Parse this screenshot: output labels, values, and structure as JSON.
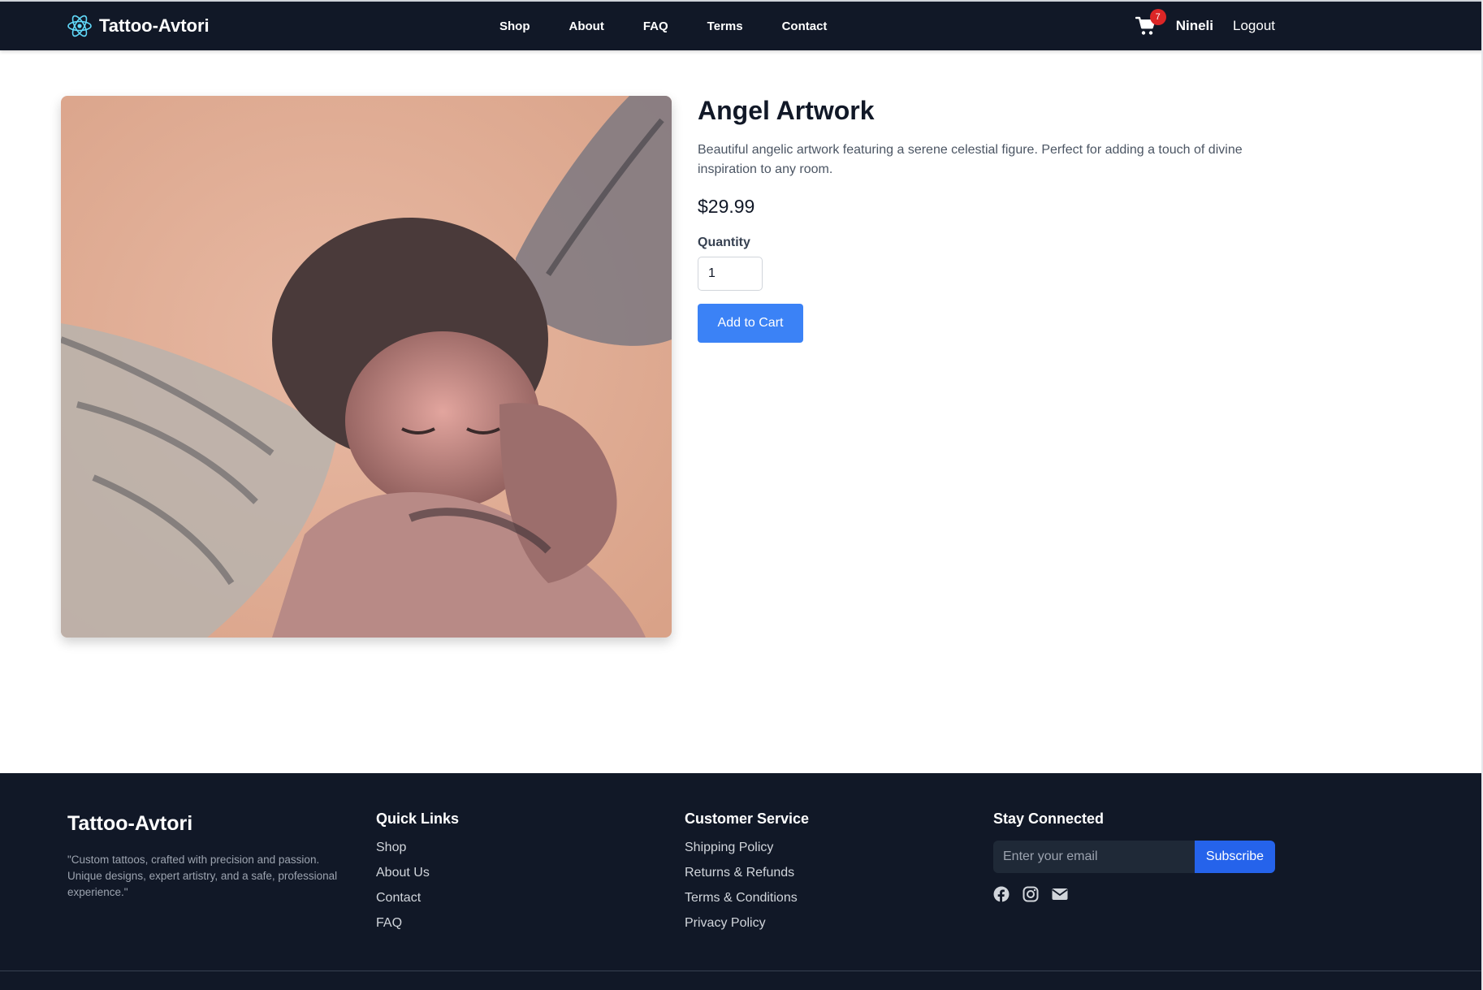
{
  "navbar": {
    "brand": "Tattoo-Avtori",
    "links": [
      "Shop",
      "About",
      "FAQ",
      "Terms",
      "Contact"
    ],
    "cart_count": "7",
    "user_name": "Nineli",
    "logout_label": "Logout"
  },
  "product": {
    "title": "Angel Artwork",
    "description": "Beautiful angelic artwork featuring a serene celestial figure. Perfect for adding a touch of divine inspiration to any room.",
    "price": "$29.99",
    "quantity_label": "Quantity",
    "quantity_value": "1",
    "add_to_cart_label": "Add to Cart"
  },
  "footer": {
    "brand": "Tattoo-Avtori",
    "quote": "\"Custom tattoos, crafted with precision and passion. Unique designs, expert artistry, and a safe, professional experience.\"",
    "quick_links": {
      "heading": "Quick Links",
      "items": [
        "Shop",
        "About Us",
        "Contact",
        "FAQ"
      ]
    },
    "customer_service": {
      "heading": "Customer Service",
      "items": [
        "Shipping Policy",
        "Returns & Refunds",
        "Terms & Conditions",
        "Privacy Policy"
      ]
    },
    "stay_connected": {
      "heading": "Stay Connected",
      "email_placeholder": "Enter your email",
      "subscribe_label": "Subscribe",
      "social_icons": [
        "facebook-icon",
        "instagram-icon",
        "envelope-icon"
      ]
    }
  },
  "colors": {
    "navbar_bg": "#111827",
    "accent": "#3b82f6",
    "badge": "#dc2626",
    "logo": "#61dafb"
  }
}
